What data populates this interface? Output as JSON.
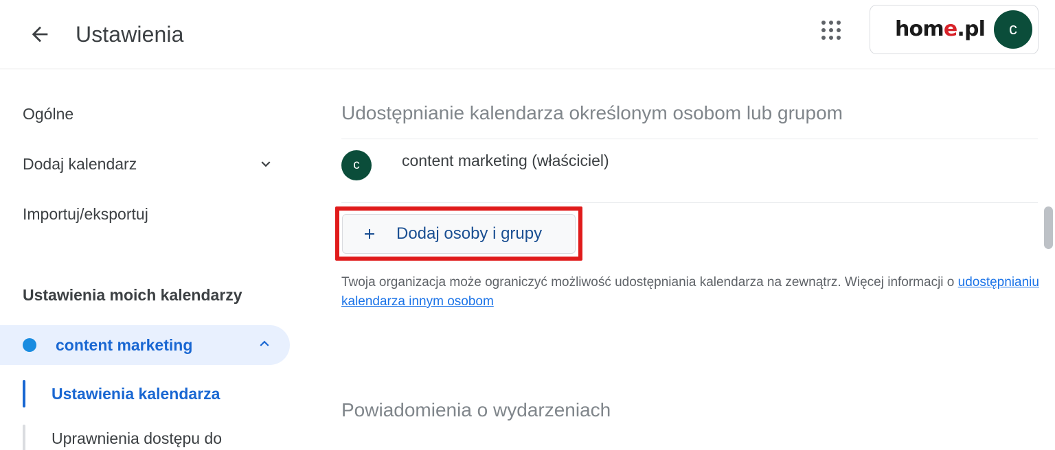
{
  "header": {
    "back_icon": "back-arrow-icon",
    "title": "Ustawienia",
    "apps_icon": "apps-grid-icon",
    "brand_prefix": "hom",
    "brand_accent": "e",
    "brand_suffix": ".pl",
    "avatar_initial": "c",
    "avatar_color": "#0b4d3a",
    "brand_accent_color": "#d8232a"
  },
  "sidebar": {
    "items": [
      {
        "label": "Ogólne",
        "icon": null
      },
      {
        "label": "Dodaj kalendarz",
        "icon": "chevron-down-icon"
      },
      {
        "label": "Importuj/eksportuj",
        "icon": null
      }
    ],
    "section_title": "Ustawienia moich kalendarzy",
    "calendar": {
      "name": "content marketing",
      "dot_color": "#1a8ce0",
      "chevron": "chevron-up-icon",
      "accent_color": "#1967d2"
    },
    "subitems": [
      {
        "label": "Ustawienia kalendarza",
        "active": true
      },
      {
        "label": "Uprawnienia dostępu do",
        "active": false
      }
    ]
  },
  "main": {
    "sharing_heading": "Udostępnianie kalendarza określonym osobom lub grupom",
    "person": {
      "avatar_initial": "c",
      "name": "content marketing (właściciel)",
      "email_redacted": true
    },
    "add_button": {
      "plus_icon": "plus-icon",
      "label": "Dodaj osoby i grupy",
      "text_color": "#1a4f92",
      "highlight_color": "#e01b1b"
    },
    "note_text_before": "Twoja organizacja może ograniczyć możliwość udostępniania kalendarza na zewnątrz. Więcej informacji o ",
    "note_link": "udostępnianiu kalendarza innym osobom",
    "notifications_heading": "Powiadomienia o wydarzeniach"
  },
  "scrollbar": {
    "thumb_label": "vertical-scrollbar-thumb"
  }
}
